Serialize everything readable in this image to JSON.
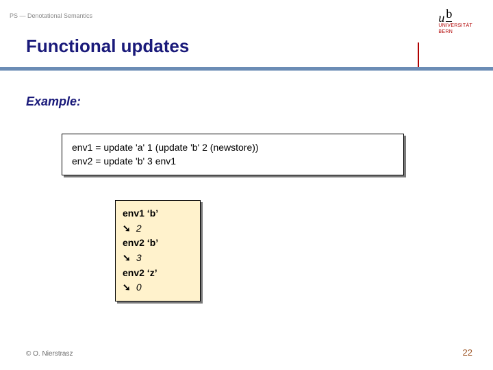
{
  "header": {
    "breadcrumb": "PS — Denotational Semantics",
    "title": "Functional updates",
    "logo": {
      "u": "u",
      "b": "b",
      "line1": "UNIVERSITÄT",
      "line2": "BERN"
    }
  },
  "content": {
    "example_label": "Example:",
    "code1": {
      "line1": "env1 = update 'a' 1 (update 'b' 2 (newstore))",
      "line2": "env2 = update 'b' 3 env1"
    },
    "code2": {
      "rows": [
        {
          "expr": "env1 ‘b’",
          "arrow": "➘",
          "val": "2"
        },
        {
          "expr": "env2 ‘b’",
          "arrow": "➘",
          "val": "3"
        },
        {
          "expr": "env2 ‘z’",
          "arrow": "➘",
          "val": "0"
        }
      ]
    }
  },
  "footer": {
    "copyright": "© O. Nierstrasz",
    "page": "22"
  }
}
